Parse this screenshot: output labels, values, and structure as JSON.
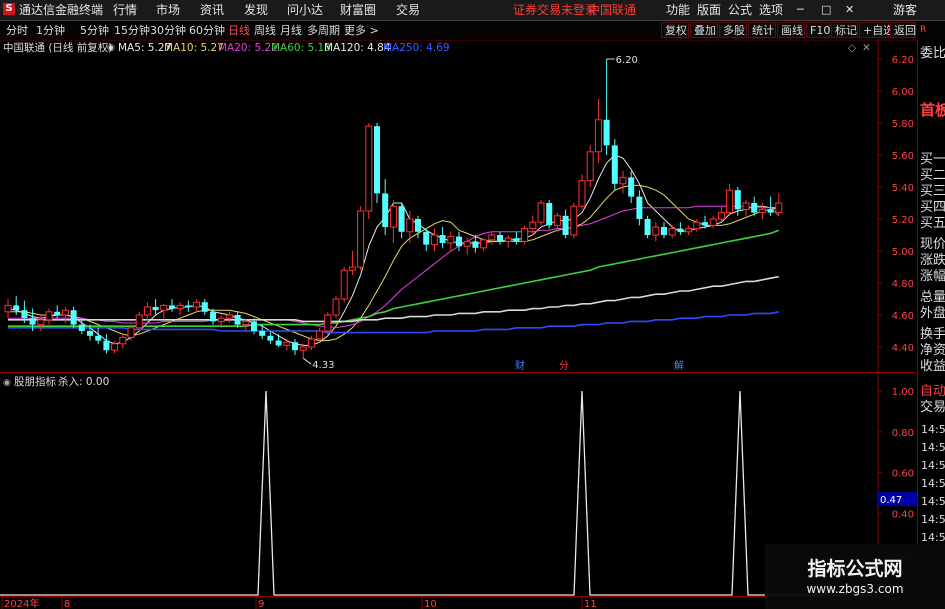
{
  "app": {
    "title": "通达信金融终端",
    "menu": [
      "行情",
      "市场",
      "资讯",
      "发现",
      "问小达",
      "财富圈",
      "交易"
    ],
    "login_status": "证券交易未登录",
    "stock_name": "中国联通",
    "right_menu": [
      "功能",
      "版面",
      "公式",
      "选项"
    ],
    "guest_label": "游客"
  },
  "period_bar": {
    "items": [
      "分时",
      "1分钟",
      "5分钟",
      "15分钟",
      "30分钟",
      "60分钟",
      "日线",
      "周线",
      "月线",
      "多周期",
      "更多 >"
    ],
    "selected": "日线",
    "tools": [
      "复权",
      "叠加",
      "多股",
      "统计",
      "画线",
      "F10",
      "标记",
      "+自选",
      "返回"
    ]
  },
  "main_info": {
    "title": "中国联通 (日线 前复权)",
    "mas": [
      {
        "label": "MA5: 5.27",
        "color": "#e8e8e8"
      },
      {
        "label": "MA10: 5.27",
        "color": "#e8d864"
      },
      {
        "label": "MA20: 5.22",
        "color": "#e040e0"
      },
      {
        "label": "MA60: 5.13",
        "color": "#40d040"
      },
      {
        "label": "MA120: 4.84",
        "color": "#e8e8e8"
      },
      {
        "label": "MA250: 4.69",
        "color": "#3a5cff"
      }
    ],
    "high_label": "6.20",
    "low_label": "4.33",
    "markers": [
      {
        "text": "财",
        "date": "2024-10-17"
      },
      {
        "text": "分",
        "date": "2024-10-30"
      },
      {
        "text": "解",
        "date": "2024-11-22"
      }
    ]
  },
  "price_axis": [
    "6.20",
    "6.00",
    "5.80",
    "5.60",
    "5.40",
    "5.20",
    "5.00",
    "4.80",
    "4.60",
    "4.40"
  ],
  "sub_info": {
    "title": "股朋指标",
    "value_label": "杀入: 0.00"
  },
  "sub_axis": [
    "1.00",
    "0.80",
    "0.60",
    "0.40",
    "0.20"
  ],
  "sub_current": "0.47",
  "date_axis": [
    "2024年",
    "8",
    "9",
    "10",
    "11"
  ],
  "chart_data": {
    "type": "candlestick",
    "title": "中国联通 (日线 前复权)",
    "ylim": [
      4.3,
      6.3
    ],
    "candles": [
      {
        "o": 4.62,
        "h": 4.7,
        "l": 4.58,
        "c": 4.66
      },
      {
        "o": 4.66,
        "h": 4.72,
        "l": 4.6,
        "c": 4.63
      },
      {
        "o": 4.63,
        "h": 4.69,
        "l": 4.55,
        "c": 4.58
      },
      {
        "o": 4.58,
        "h": 4.64,
        "l": 4.5,
        "c": 4.54
      },
      {
        "o": 4.54,
        "h": 4.6,
        "l": 4.5,
        "c": 4.57
      },
      {
        "o": 4.57,
        "h": 4.64,
        "l": 4.54,
        "c": 4.62
      },
      {
        "o": 4.62,
        "h": 4.66,
        "l": 4.58,
        "c": 4.6
      },
      {
        "o": 4.6,
        "h": 4.65,
        "l": 4.55,
        "c": 4.63
      },
      {
        "o": 4.63,
        "h": 4.65,
        "l": 4.52,
        "c": 4.54
      },
      {
        "o": 4.54,
        "h": 4.58,
        "l": 4.48,
        "c": 4.5
      },
      {
        "o": 4.5,
        "h": 4.54,
        "l": 4.44,
        "c": 4.47
      },
      {
        "o": 4.47,
        "h": 4.52,
        "l": 4.42,
        "c": 4.44
      },
      {
        "o": 4.44,
        "h": 4.48,
        "l": 4.36,
        "c": 4.38
      },
      {
        "o": 4.38,
        "h": 4.44,
        "l": 4.36,
        "c": 4.42
      },
      {
        "o": 4.42,
        "h": 4.48,
        "l": 4.39,
        "c": 4.46
      },
      {
        "o": 4.46,
        "h": 4.54,
        "l": 4.44,
        "c": 4.52
      },
      {
        "o": 4.52,
        "h": 4.62,
        "l": 4.5,
        "c": 4.6
      },
      {
        "o": 4.6,
        "h": 4.68,
        "l": 4.56,
        "c": 4.65
      },
      {
        "o": 4.65,
        "h": 4.7,
        "l": 4.6,
        "c": 4.63
      },
      {
        "o": 4.63,
        "h": 4.67,
        "l": 4.58,
        "c": 4.66
      },
      {
        "o": 4.66,
        "h": 4.7,
        "l": 4.62,
        "c": 4.64
      },
      {
        "o": 4.64,
        "h": 4.68,
        "l": 4.6,
        "c": 4.66
      },
      {
        "o": 4.66,
        "h": 4.69,
        "l": 4.62,
        "c": 4.65
      },
      {
        "o": 4.65,
        "h": 4.7,
        "l": 4.62,
        "c": 4.68
      },
      {
        "o": 4.68,
        "h": 4.7,
        "l": 4.6,
        "c": 4.62
      },
      {
        "o": 4.62,
        "h": 4.64,
        "l": 4.54,
        "c": 4.56
      },
      {
        "o": 4.56,
        "h": 4.6,
        "l": 4.52,
        "c": 4.58
      },
      {
        "o": 4.58,
        "h": 4.62,
        "l": 4.55,
        "c": 4.6
      },
      {
        "o": 4.6,
        "h": 4.62,
        "l": 4.52,
        "c": 4.54
      },
      {
        "o": 4.54,
        "h": 4.58,
        "l": 4.5,
        "c": 4.56
      },
      {
        "o": 4.56,
        "h": 4.58,
        "l": 4.48,
        "c": 4.5
      },
      {
        "o": 4.5,
        "h": 4.54,
        "l": 4.45,
        "c": 4.47
      },
      {
        "o": 4.47,
        "h": 4.5,
        "l": 4.42,
        "c": 4.44
      },
      {
        "o": 4.44,
        "h": 4.48,
        "l": 4.4,
        "c": 4.41
      },
      {
        "o": 4.41,
        "h": 4.45,
        "l": 4.38,
        "c": 4.43
      },
      {
        "o": 4.43,
        "h": 4.45,
        "l": 4.35,
        "c": 4.38
      },
      {
        "o": 4.38,
        "h": 4.42,
        "l": 4.33,
        "c": 4.4
      },
      {
        "o": 4.4,
        "h": 4.47,
        "l": 4.38,
        "c": 4.45
      },
      {
        "o": 4.45,
        "h": 4.52,
        "l": 4.43,
        "c": 4.5
      },
      {
        "o": 4.5,
        "h": 4.62,
        "l": 4.48,
        "c": 4.6
      },
      {
        "o": 4.6,
        "h": 4.72,
        "l": 4.58,
        "c": 4.7
      },
      {
        "o": 4.7,
        "h": 4.9,
        "l": 4.68,
        "c": 4.88
      },
      {
        "o": 4.88,
        "h": 5.0,
        "l": 4.85,
        "c": 4.9
      },
      {
        "o": 4.9,
        "h": 5.28,
        "l": 4.88,
        "c": 5.25
      },
      {
        "o": 5.25,
        "h": 5.8,
        "l": 5.2,
        "c": 5.78
      },
      {
        "o": 5.78,
        "h": 5.8,
        "l": 5.3,
        "c": 5.36
      },
      {
        "o": 5.36,
        "h": 5.45,
        "l": 5.1,
        "c": 5.15
      },
      {
        "o": 5.15,
        "h": 5.32,
        "l": 5.05,
        "c": 5.28
      },
      {
        "o": 5.28,
        "h": 5.3,
        "l": 5.08,
        "c": 5.12
      },
      {
        "o": 5.12,
        "h": 5.25,
        "l": 5.05,
        "c": 5.2
      },
      {
        "o": 5.2,
        "h": 5.22,
        "l": 5.08,
        "c": 5.12
      },
      {
        "o": 5.12,
        "h": 5.14,
        "l": 5.0,
        "c": 5.04
      },
      {
        "o": 5.04,
        "h": 5.14,
        "l": 5.0,
        "c": 5.1
      },
      {
        "o": 5.1,
        "h": 5.15,
        "l": 5.02,
        "c": 5.05
      },
      {
        "o": 5.05,
        "h": 5.12,
        "l": 5.0,
        "c": 5.09
      },
      {
        "o": 5.09,
        "h": 5.12,
        "l": 5.0,
        "c": 5.03
      },
      {
        "o": 5.03,
        "h": 5.08,
        "l": 4.98,
        "c": 5.06
      },
      {
        "o": 5.06,
        "h": 5.1,
        "l": 4.99,
        "c": 5.02
      },
      {
        "o": 5.02,
        "h": 5.08,
        "l": 5.0,
        "c": 5.07
      },
      {
        "o": 5.07,
        "h": 5.12,
        "l": 5.04,
        "c": 5.1
      },
      {
        "o": 5.1,
        "h": 5.12,
        "l": 5.04,
        "c": 5.06
      },
      {
        "o": 5.06,
        "h": 5.1,
        "l": 5.02,
        "c": 5.08
      },
      {
        "o": 5.08,
        "h": 5.12,
        "l": 5.04,
        "c": 5.06
      },
      {
        "o": 5.06,
        "h": 5.16,
        "l": 5.04,
        "c": 5.14
      },
      {
        "o": 5.14,
        "h": 5.22,
        "l": 5.1,
        "c": 5.18
      },
      {
        "o": 5.18,
        "h": 5.32,
        "l": 5.16,
        "c": 5.3
      },
      {
        "o": 5.3,
        "h": 5.32,
        "l": 5.14,
        "c": 5.16
      },
      {
        "o": 5.16,
        "h": 5.24,
        "l": 5.12,
        "c": 5.22
      },
      {
        "o": 5.22,
        "h": 5.26,
        "l": 5.08,
        "c": 5.1
      },
      {
        "o": 5.1,
        "h": 5.3,
        "l": 5.08,
        "c": 5.28
      },
      {
        "o": 5.28,
        "h": 5.48,
        "l": 5.26,
        "c": 5.44
      },
      {
        "o": 5.44,
        "h": 5.66,
        "l": 5.4,
        "c": 5.62
      },
      {
        "o": 5.62,
        "h": 5.95,
        "l": 5.55,
        "c": 5.82
      },
      {
        "o": 5.82,
        "h": 6.2,
        "l": 5.6,
        "c": 5.66
      },
      {
        "o": 5.66,
        "h": 5.7,
        "l": 5.38,
        "c": 5.42
      },
      {
        "o": 5.42,
        "h": 5.5,
        "l": 5.36,
        "c": 5.46
      },
      {
        "o": 5.46,
        "h": 5.5,
        "l": 5.3,
        "c": 5.34
      },
      {
        "o": 5.34,
        "h": 5.38,
        "l": 5.16,
        "c": 5.2
      },
      {
        "o": 5.2,
        "h": 5.22,
        "l": 5.08,
        "c": 5.1
      },
      {
        "o": 5.1,
        "h": 5.18,
        "l": 5.06,
        "c": 5.15
      },
      {
        "o": 5.15,
        "h": 5.18,
        "l": 5.08,
        "c": 5.1
      },
      {
        "o": 5.1,
        "h": 5.16,
        "l": 5.08,
        "c": 5.14
      },
      {
        "o": 5.14,
        "h": 5.18,
        "l": 5.1,
        "c": 5.12
      },
      {
        "o": 5.12,
        "h": 5.16,
        "l": 5.1,
        "c": 5.14
      },
      {
        "o": 5.14,
        "h": 5.2,
        "l": 5.12,
        "c": 5.18
      },
      {
        "o": 5.18,
        "h": 5.22,
        "l": 5.14,
        "c": 5.16
      },
      {
        "o": 5.16,
        "h": 5.22,
        "l": 5.14,
        "c": 5.2
      },
      {
        "o": 5.2,
        "h": 5.28,
        "l": 5.18,
        "c": 5.24
      },
      {
        "o": 5.24,
        "h": 5.42,
        "l": 5.22,
        "c": 5.38
      },
      {
        "o": 5.38,
        "h": 5.4,
        "l": 5.22,
        "c": 5.26
      },
      {
        "o": 5.26,
        "h": 5.32,
        "l": 5.22,
        "c": 5.3
      },
      {
        "o": 5.3,
        "h": 5.34,
        "l": 5.22,
        "c": 5.24
      },
      {
        "o": 5.24,
        "h": 5.3,
        "l": 5.2,
        "c": 5.26
      },
      {
        "o": 5.26,
        "h": 5.34,
        "l": 5.22,
        "c": 5.24
      },
      {
        "o": 5.24,
        "h": 5.36,
        "l": 5.22,
        "c": 5.3
      }
    ],
    "ma": {
      "MA5": [
        4.64,
        4.63,
        4.61,
        4.59,
        4.58,
        4.59,
        4.6,
        4.6,
        4.59,
        4.55,
        4.52,
        4.48,
        4.44,
        4.42,
        4.43,
        4.46,
        4.5,
        4.55,
        4.6,
        4.63,
        4.64,
        4.65,
        4.65,
        4.66,
        4.65,
        4.62,
        4.61,
        4.6,
        4.58,
        4.57,
        4.55,
        4.53,
        4.5,
        4.47,
        4.44,
        4.42,
        4.41,
        4.41,
        4.43,
        4.47,
        4.53,
        4.62,
        4.72,
        4.85,
        5.03,
        5.15,
        5.21,
        5.3,
        5.3,
        5.2,
        5.17,
        5.13,
        5.1,
        5.08,
        5.06,
        5.05,
        5.05,
        5.05,
        5.05,
        5.06,
        5.06,
        5.07,
        5.07,
        5.08,
        5.1,
        5.15,
        5.17,
        5.19,
        5.19,
        5.2,
        5.24,
        5.33,
        5.45,
        5.55,
        5.6,
        5.58,
        5.51,
        5.42,
        5.3,
        5.25,
        5.2,
        5.15,
        5.12,
        5.13,
        5.14,
        5.15,
        5.16,
        5.18,
        5.23,
        5.25,
        5.26,
        5.28,
        5.28,
        5.27,
        5.27
      ],
      "MA10": [
        4.62,
        4.62,
        4.62,
        4.61,
        4.6,
        4.6,
        4.6,
        4.6,
        4.59,
        4.58,
        4.56,
        4.54,
        4.52,
        4.5,
        4.48,
        4.47,
        4.48,
        4.5,
        4.52,
        4.54,
        4.56,
        4.58,
        4.6,
        4.62,
        4.63,
        4.63,
        4.63,
        4.63,
        4.62,
        4.61,
        4.59,
        4.57,
        4.55,
        4.53,
        4.51,
        4.49,
        4.47,
        4.45,
        4.44,
        4.44,
        4.45,
        4.48,
        4.52,
        4.58,
        4.66,
        4.75,
        4.84,
        4.94,
        5.03,
        5.08,
        5.11,
        5.14,
        5.17,
        5.19,
        5.18,
        5.13,
        5.11,
        5.09,
        5.07,
        5.06,
        5.06,
        5.06,
        5.06,
        5.06,
        5.07,
        5.09,
        5.11,
        5.13,
        5.14,
        5.15,
        5.17,
        5.21,
        5.27,
        5.33,
        5.38,
        5.4,
        5.41,
        5.41,
        5.4,
        5.38,
        5.35,
        5.3,
        5.25,
        5.2,
        5.18,
        5.16,
        5.16,
        5.16,
        5.17,
        5.19,
        5.21,
        5.23,
        5.25,
        5.26,
        5.27
      ],
      "MA20": [
        4.58,
        4.58,
        4.58,
        4.58,
        4.58,
        4.58,
        4.58,
        4.58,
        4.58,
        4.58,
        4.57,
        4.57,
        4.56,
        4.56,
        4.55,
        4.55,
        4.55,
        4.55,
        4.55,
        4.56,
        4.56,
        4.56,
        4.56,
        4.56,
        4.56,
        4.57,
        4.57,
        4.57,
        4.57,
        4.57,
        4.57,
        4.57,
        4.57,
        4.57,
        4.57,
        4.56,
        4.55,
        4.54,
        4.53,
        4.53,
        4.52,
        4.53,
        4.54,
        4.56,
        4.59,
        4.62,
        4.66,
        4.71,
        4.76,
        4.8,
        4.84,
        4.88,
        4.92,
        4.96,
        5.0,
        5.03,
        5.06,
        5.09,
        5.11,
        5.12,
        5.12,
        5.12,
        5.12,
        5.12,
        5.12,
        5.13,
        5.13,
        5.14,
        5.14,
        5.15,
        5.16,
        5.17,
        5.19,
        5.21,
        5.23,
        5.25,
        5.26,
        5.27,
        5.27,
        5.27,
        5.27,
        5.27,
        5.27,
        5.27,
        5.28,
        5.28,
        5.28,
        5.28,
        5.28,
        5.28,
        5.28,
        5.27,
        5.27,
        5.27,
        5.22
      ],
      "MA60": [
        4.53,
        4.53,
        4.53,
        4.53,
        4.53,
        4.53,
        4.53,
        4.53,
        4.53,
        4.53,
        4.53,
        4.53,
        4.53,
        4.53,
        4.53,
        4.53,
        4.53,
        4.53,
        4.53,
        4.53,
        4.53,
        4.53,
        4.53,
        4.53,
        4.53,
        4.53,
        4.53,
        4.53,
        4.53,
        4.53,
        4.54,
        4.54,
        4.54,
        4.54,
        4.54,
        4.54,
        4.54,
        4.54,
        4.54,
        4.55,
        4.55,
        4.56,
        4.57,
        4.58,
        4.59,
        4.61,
        4.62,
        4.64,
        4.65,
        4.66,
        4.67,
        4.68,
        4.69,
        4.7,
        4.71,
        4.72,
        4.73,
        4.74,
        4.75,
        4.76,
        4.77,
        4.78,
        4.79,
        4.8,
        4.81,
        4.82,
        4.83,
        4.84,
        4.85,
        4.86,
        4.87,
        4.88,
        4.9,
        4.91,
        4.92,
        4.93,
        4.94,
        4.95,
        4.96,
        4.97,
        4.98,
        4.99,
        5.0,
        5.01,
        5.02,
        5.03,
        5.04,
        5.05,
        5.06,
        5.07,
        5.08,
        5.09,
        5.1,
        5.11,
        5.13
      ],
      "MA120": [
        4.57,
        4.57,
        4.57,
        4.57,
        4.57,
        4.57,
        4.57,
        4.57,
        4.57,
        4.57,
        4.57,
        4.57,
        4.57,
        4.57,
        4.57,
        4.57,
        4.57,
        4.57,
        4.57,
        4.57,
        4.57,
        4.57,
        4.57,
        4.57,
        4.57,
        4.57,
        4.57,
        4.57,
        4.57,
        4.57,
        4.57,
        4.57,
        4.57,
        4.57,
        4.57,
        4.57,
        4.56,
        4.56,
        4.56,
        4.56,
        4.56,
        4.56,
        4.56,
        4.57,
        4.57,
        4.57,
        4.58,
        4.58,
        4.58,
        4.59,
        4.59,
        4.59,
        4.6,
        4.6,
        4.6,
        4.61,
        4.61,
        4.61,
        4.62,
        4.62,
        4.62,
        4.63,
        4.63,
        4.63,
        4.64,
        4.64,
        4.65,
        4.65,
        4.66,
        4.66,
        4.67,
        4.67,
        4.68,
        4.69,
        4.69,
        4.7,
        4.71,
        4.71,
        4.72,
        4.73,
        4.73,
        4.74,
        4.75,
        4.75,
        4.76,
        4.77,
        4.78,
        4.78,
        4.79,
        4.8,
        4.81,
        4.81,
        4.82,
        4.83,
        4.84
      ],
      "MA250": [
        4.52,
        4.52,
        4.52,
        4.52,
        4.52,
        4.52,
        4.52,
        4.52,
        4.52,
        4.52,
        4.52,
        4.52,
        4.52,
        4.52,
        4.52,
        4.51,
        4.51,
        4.51,
        4.51,
        4.51,
        4.51,
        4.51,
        4.51,
        4.51,
        4.51,
        4.51,
        4.5,
        4.5,
        4.5,
        4.5,
        4.5,
        4.5,
        4.5,
        4.5,
        4.5,
        4.5,
        4.5,
        4.5,
        4.5,
        4.49,
        4.49,
        4.49,
        4.49,
        4.49,
        4.49,
        4.49,
        4.49,
        4.49,
        4.49,
        4.49,
        4.49,
        4.49,
        4.5,
        4.5,
        4.5,
        4.5,
        4.5,
        4.5,
        4.51,
        4.51,
        4.51,
        4.51,
        4.52,
        4.52,
        4.52,
        4.52,
        4.53,
        4.53,
        4.53,
        4.53,
        4.54,
        4.54,
        4.54,
        4.55,
        4.55,
        4.55,
        4.56,
        4.56,
        4.56,
        4.57,
        4.57,
        4.57,
        4.58,
        4.58,
        4.58,
        4.59,
        4.59,
        4.59,
        4.6,
        4.6,
        4.6,
        4.61,
        4.61,
        4.61,
        4.62
      ]
    },
    "indicator": {
      "name": "股朋指标",
      "series": "杀入",
      "ylim": [
        0,
        1.05
      ],
      "spike_indices": [
        21,
        61,
        78
      ],
      "value": 0.0
    },
    "colors": {
      "up": "#ff3030",
      "down": "#54ffff",
      "grid": "#3a0000"
    }
  },
  "right_panel": {
    "top": [
      "委比"
    ],
    "big": "首板",
    "quotes": [
      "买一",
      "买二",
      "买三",
      "买四",
      "买五",
      "现价",
      "涨跌",
      "涨幅",
      "总量",
      "外盘",
      "换手",
      "净资",
      "收益"
    ],
    "bottom_labels": [
      "自动",
      "交易"
    ],
    "times": [
      "14:56",
      "14:56",
      "14:56",
      "14:56",
      "14:56",
      "14:56",
      "14:56"
    ]
  },
  "watermark": {
    "title": "指标公式网",
    "url": "www.zbgs3.com"
  }
}
